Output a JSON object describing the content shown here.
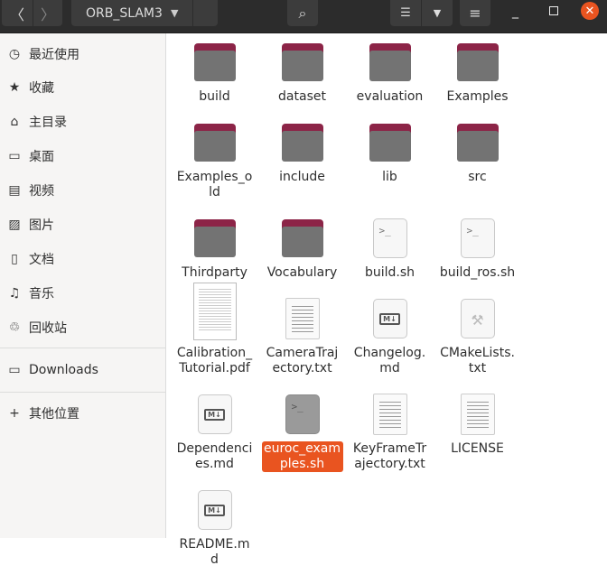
{
  "header": {
    "path": "ORB_SLAM3"
  },
  "sidebar": {
    "items": [
      {
        "icon": "clock-icon",
        "glyph": "◷",
        "label": "最近使用"
      },
      {
        "icon": "star-icon",
        "glyph": "★",
        "label": "收藏"
      },
      {
        "icon": "home-icon",
        "glyph": "⌂",
        "label": "主目录"
      },
      {
        "icon": "desktop-icon",
        "glyph": "▭",
        "label": "桌面"
      },
      {
        "icon": "video-icon",
        "glyph": "▤",
        "label": "视频"
      },
      {
        "icon": "picture-icon",
        "glyph": "▨",
        "label": "图片"
      },
      {
        "icon": "document-icon",
        "glyph": "▯",
        "label": "文档"
      },
      {
        "icon": "music-icon",
        "glyph": "♫",
        "label": "音乐"
      },
      {
        "icon": "trash-icon",
        "glyph": "♲",
        "label": "回收站"
      },
      {
        "icon": "folder-icon",
        "glyph": "▭",
        "label": "Downloads"
      },
      {
        "icon": "plus-icon",
        "glyph": "+",
        "label": "其他位置"
      }
    ]
  },
  "files": [
    {
      "name": "build",
      "type": "folder"
    },
    {
      "name": "dataset",
      "type": "folder"
    },
    {
      "name": "evaluation",
      "type": "folder"
    },
    {
      "name": "Examples",
      "type": "folder"
    },
    {
      "name": "Examples_old",
      "type": "folder"
    },
    {
      "name": "include",
      "type": "folder"
    },
    {
      "name": "lib",
      "type": "folder"
    },
    {
      "name": "src",
      "type": "folder"
    },
    {
      "name": "Thirdparty",
      "type": "folder"
    },
    {
      "name": "Vocabulary",
      "type": "folder"
    },
    {
      "name": "build.sh",
      "type": "script"
    },
    {
      "name": "build_ros.sh",
      "type": "script"
    },
    {
      "name": "Calibration_Tutorial.pdf",
      "type": "pdf"
    },
    {
      "name": "CameraTrajectory.txt",
      "type": "text"
    },
    {
      "name": "Changelog.md",
      "type": "markdown"
    },
    {
      "name": "CMakeLists.txt",
      "type": "cmake"
    },
    {
      "name": "Dependencies.md",
      "type": "markdown"
    },
    {
      "name": "euroc_examples.sh",
      "type": "script",
      "selected": true
    },
    {
      "name": "KeyFrameTrajectory.txt",
      "type": "text"
    },
    {
      "name": "LICENSE",
      "type": "text"
    },
    {
      "name": "README.md",
      "type": "markdown"
    }
  ],
  "colors": {
    "accent": "#e95420",
    "folder": "#8c2447"
  }
}
